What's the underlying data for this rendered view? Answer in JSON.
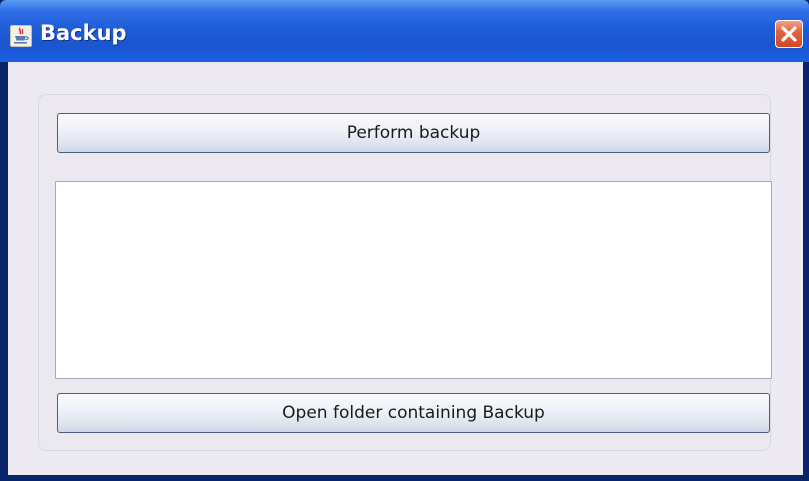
{
  "window": {
    "title": "Backup",
    "icon": "java-cup-icon",
    "close_icon": "close-icon"
  },
  "buttons": {
    "perform_backup": "Perform backup",
    "open_folder": "Open folder containing Backup"
  },
  "output": {
    "text": ""
  },
  "colors": {
    "titlebar": "#1f5ed8",
    "close": "#d6451f",
    "client_bg": "#ece9f2",
    "button_border": "#4a5f84"
  }
}
